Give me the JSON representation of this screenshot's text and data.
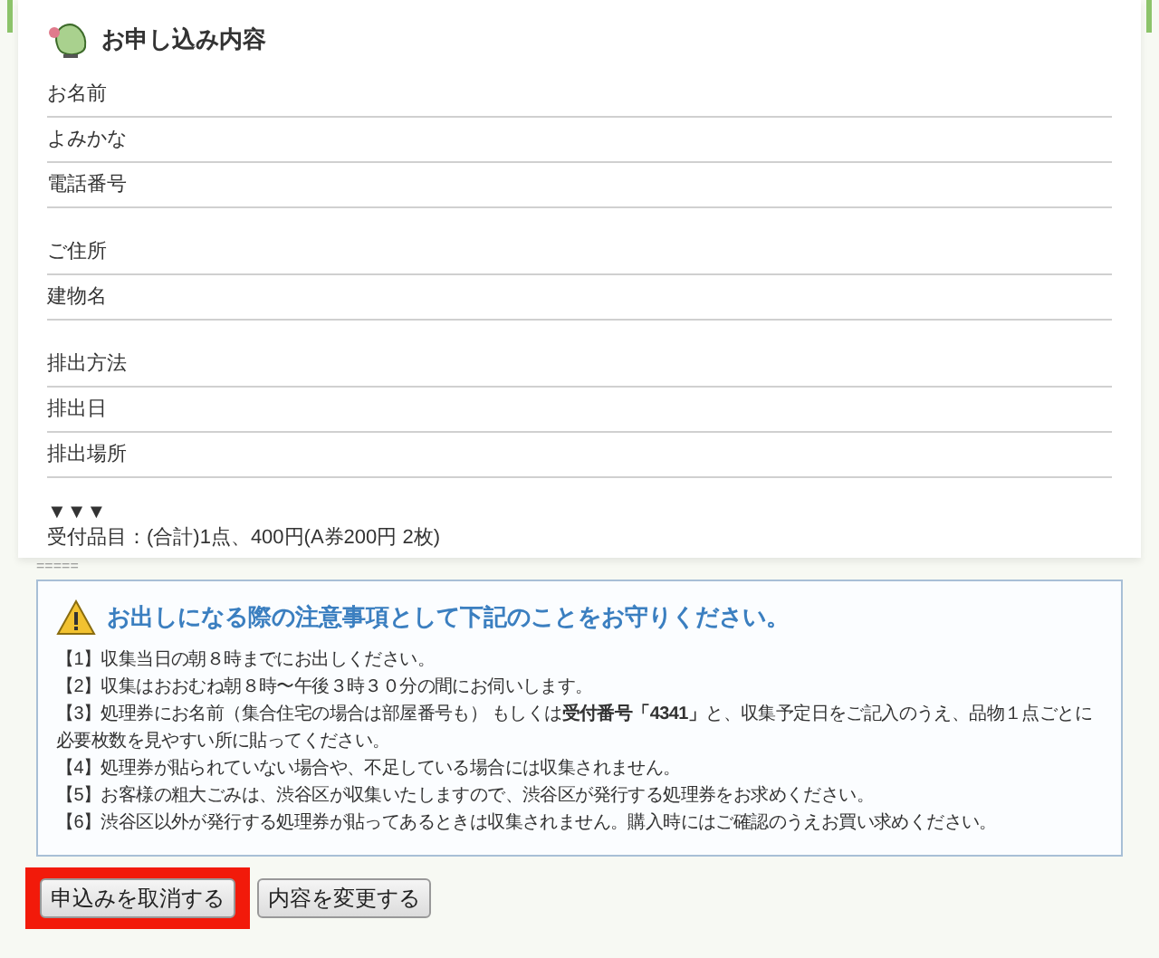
{
  "heading": "お申し込み内容",
  "field_groups": [
    {
      "fields": [
        "お名前",
        "よみかな",
        "電話番号"
      ]
    },
    {
      "fields": [
        "ご住所",
        "建物名"
      ]
    },
    {
      "fields": [
        "排出方法",
        "排出日",
        "排出場所"
      ]
    }
  ],
  "marker": "▼▼▼",
  "summary": "受付品目：(合計)1点、400円(A券200円 2枚)",
  "separator": "=====",
  "notice": {
    "title": "お出しになる際の注意事項として下記のことをお守りください。",
    "items": [
      "【1】収集当日の朝８時までにお出しください。",
      "【2】収集はおおむね朝８時〜午後３時３０分の間にお伺いします。",
      "【3】処理券にお名前（集合住宅の場合は部屋番号も） もしくは**受付番号「4341」**と、収集予定日をご記入のうえ、品物１点ごとに必要枚数を見やすい所に貼ってください。",
      "【4】処理券が貼られていない場合や、不足している場合には収集されません。",
      "【5】お客様の粗大ごみは、渋谷区が収集いたしますので、渋谷区が発行する処理券をお求めください。",
      "【6】渋谷区以外が発行する処理券が貼ってあるときは収集されません。購入時にはご確認のうえお買い求めください。"
    ]
  },
  "buttons": [
    {
      "label": "申込みを取消する",
      "highlighted": true
    },
    {
      "label": "内容を変更する",
      "highlighted": false
    }
  ]
}
